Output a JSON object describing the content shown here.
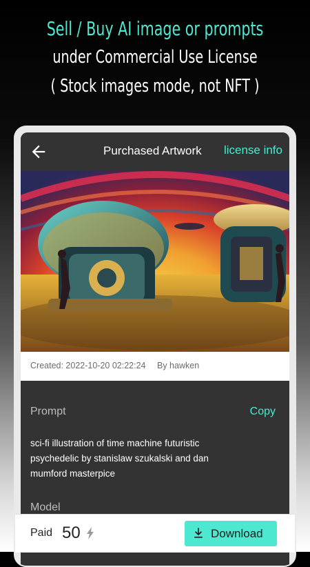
{
  "promo": {
    "line1": "Sell / Buy AI image or prompts",
    "line2": "under Commercial Use License",
    "line3": "( Stock images mode, not NFT )"
  },
  "appbar": {
    "back_icon": "arrow-left-icon",
    "title": "Purchased Artwork",
    "license_link": "license info"
  },
  "artwork": {
    "description_icon": "artwork-image"
  },
  "meta": {
    "created": "Created: 2022-10-20 02:22:24",
    "by": "By hawken"
  },
  "details": {
    "prompt_label": "Prompt",
    "copy_label": "Copy",
    "prompt_text": "sci-fi illustration of time machine futuristic psychedelic by stanislaw szukalski and dan mumford masterpice",
    "model_label": "Model"
  },
  "footer": {
    "paid_label": "Paid",
    "price": "50",
    "currency_icon": "lightning-bolt-icon",
    "download_label": "Download",
    "download_icon": "download-icon"
  },
  "colors": {
    "accent": "#4ee8d0",
    "panel": "#333333"
  }
}
